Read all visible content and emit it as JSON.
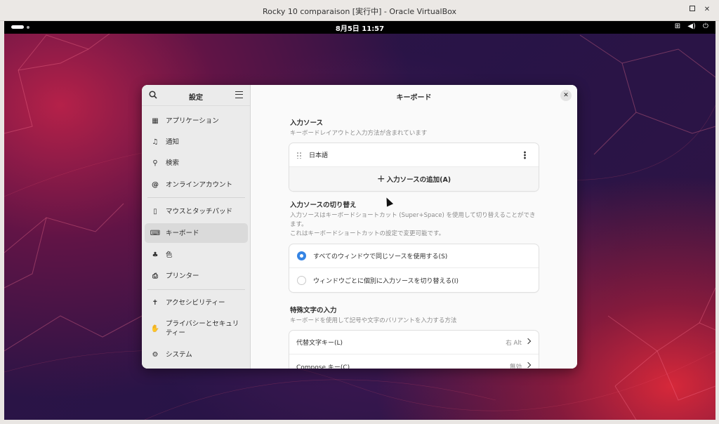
{
  "vbox": {
    "title": "Rocky 10 comparaison [実行中] - Oracle VirtualBox"
  },
  "topbar": {
    "clock": "8月5日  11:57"
  },
  "settings": {
    "sidebar": {
      "title": "設定",
      "items": [
        {
          "label": "アプリケーション",
          "icon": "apps-grid-icon"
        },
        {
          "label": "通知",
          "icon": "bell-icon"
        },
        {
          "label": "検索",
          "icon": "search-icon"
        },
        {
          "label": "オンラインアカウント",
          "icon": "at-icon"
        },
        {
          "label": "マウスとタッチパッド",
          "icon": "mouse-icon"
        },
        {
          "label": "キーボード",
          "icon": "keyboard-icon",
          "active": true
        },
        {
          "label": "色",
          "icon": "color-icon"
        },
        {
          "label": "プリンター",
          "icon": "printer-icon"
        },
        {
          "label": "アクセシビリティー",
          "icon": "accessibility-icon"
        },
        {
          "label": "プライバシーとセキュリティー",
          "icon": "hand-icon"
        },
        {
          "label": "システム",
          "icon": "gear-icon"
        }
      ]
    },
    "main": {
      "title": "キーボード",
      "input_sources": {
        "title": "入力ソース",
        "desc": "キーボードレイアウトと入力方法が含まれています",
        "items": [
          "日本語"
        ],
        "add_label": "入力ソースの追加(A)"
      },
      "switching": {
        "title": "入力ソースの切り替え",
        "desc1": "入力ソースはキーボードショートカット (Super+Space) を使用して切り替えることができます。",
        "desc2": "これはキーボードショートカットの設定で変更可能です。",
        "options": [
          {
            "label": "すべてのウィンドウで同じソースを使用する(S)",
            "selected": true
          },
          {
            "label": "ウィンドウごとに個別に入力ソースを切り替える(I)",
            "selected": false
          }
        ]
      },
      "special": {
        "title": "特殊文字の入力",
        "desc": "キーボードを使用して記号や文字のバリアントを入力する方法",
        "rows": [
          {
            "label": "代替文字キー(L)",
            "value": "右 Alt"
          },
          {
            "label": "Compose キー(C)",
            "value": "無効"
          }
        ]
      }
    }
  },
  "colors": {
    "accent": "#3584e4"
  }
}
